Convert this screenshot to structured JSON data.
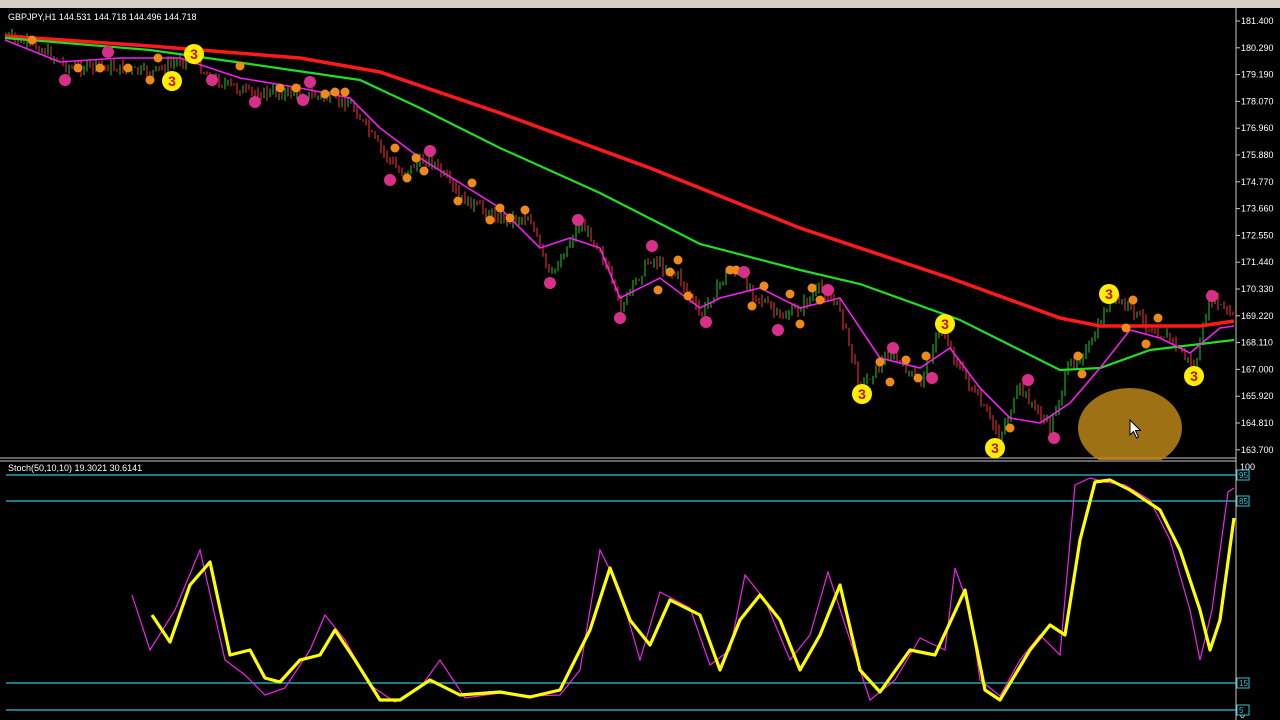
{
  "main_chart": {
    "header": "GBPJPY,H1  144.531 144.718 144.496 144.718",
    "price_labels": [
      "181.400",
      "180.290",
      "179.190",
      "178.070",
      "176.960",
      "175.880",
      "174.770",
      "173.660",
      "172.550",
      "171.440",
      "170.330",
      "169.220",
      "168.110",
      "167.000",
      "165.920",
      "164.810",
      "163.700"
    ],
    "marker_number": "3",
    "colors": {
      "background": "#000000",
      "ma_slow": "#ff1a1a",
      "ma_mid": "#22dd22",
      "ma_fast": "#ee22ee",
      "bull_bar": "#22cc22",
      "bear_bar": "#ff3333",
      "marker": "#ffee00"
    }
  },
  "indicator": {
    "header": "Stoch(50,10,10) 19.3021 30.6141",
    "top_scale": "100",
    "bottom_scale": "0",
    "levels": [
      "95",
      "85",
      "15",
      "5"
    ],
    "colors": {
      "main": "#ffff00",
      "signal": "#ee22ee",
      "level_line": "#2fc4d0"
    }
  },
  "icons": [
    "arrow-cursor-icon",
    "highlight-circle-icon"
  ]
}
